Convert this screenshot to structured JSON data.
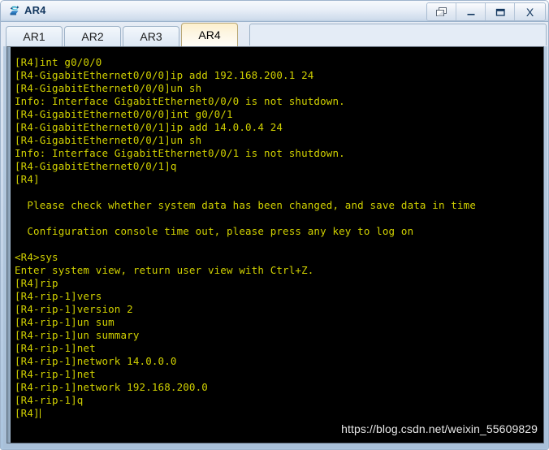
{
  "window": {
    "title": "AR4",
    "icon": "ensp-router-icon",
    "controls": [
      {
        "name": "restore-windows-button",
        "glyph": "restore-icon",
        "label": "Restore"
      },
      {
        "name": "minimize-button",
        "glyph": "minimize-icon",
        "label": "_"
      },
      {
        "name": "maximize-button",
        "glyph": "maximize-icon",
        "label": "Maximize"
      },
      {
        "name": "close-button",
        "glyph": "close-icon",
        "label": "X"
      }
    ]
  },
  "tabs": [
    {
      "label": "AR1",
      "active": false
    },
    {
      "label": "AR2",
      "active": false
    },
    {
      "label": "AR3",
      "active": false
    },
    {
      "label": "AR4",
      "active": true
    }
  ],
  "terminal": {
    "foreground": "#d0d000",
    "background": "#000000",
    "cursor_visible": true,
    "lines": [
      "[R4]int g0/0/0",
      "[R4-GigabitEthernet0/0/0]ip add 192.168.200.1 24",
      "[R4-GigabitEthernet0/0/0]un sh",
      "Info: Interface GigabitEthernet0/0/0 is not shutdown.",
      "[R4-GigabitEthernet0/0/0]int g0/0/1",
      "[R4-GigabitEthernet0/0/1]ip add 14.0.0.4 24",
      "[R4-GigabitEthernet0/0/1]un sh",
      "Info: Interface GigabitEthernet0/0/1 is not shutdown.",
      "[R4-GigabitEthernet0/0/1]q",
      "[R4]",
      "",
      "  Please check whether system data has been changed, and save data in time",
      "",
      "  Configuration console time out, please press any key to log on",
      "",
      "<R4>sys",
      "Enter system view, return user view with Ctrl+Z.",
      "[R4]rip",
      "[R4-rip-1]vers",
      "[R4-rip-1]version 2",
      "[R4-rip-1]un sum",
      "[R4-rip-1]un summary",
      "[R4-rip-1]net",
      "[R4-rip-1]network 14.0.0.0",
      "[R4-rip-1]net",
      "[R4-rip-1]network 192.168.200.0",
      "[R4-rip-1]q"
    ],
    "prompt_line": "[R4]"
  },
  "watermark": {
    "text": "https://blog.csdn.net/weixin_55609829"
  }
}
